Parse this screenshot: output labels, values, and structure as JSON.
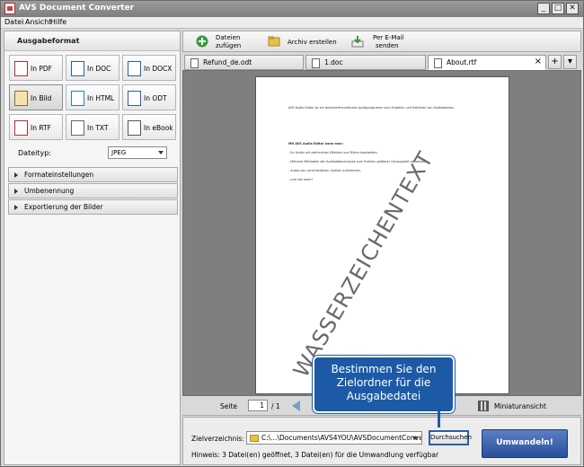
{
  "window": {
    "title": "AVS Document Converter",
    "controls": {
      "minimize": "_",
      "maximize": "□",
      "close": "✕"
    }
  },
  "menu": [
    "Datei",
    "Ansicht",
    "Hilfe"
  ],
  "left_panel": {
    "header": "Ausgabeformat",
    "formats": [
      "In PDF",
      "In DOC",
      "In DOCX",
      "In Bild",
      "In HTML",
      "In ODT",
      "In RTF",
      "In TXT",
      "In eBook"
    ],
    "active_format": "In Bild",
    "dateityp_label": "Dateityp:",
    "dateityp_value": "JPEG",
    "sections": [
      "Formateinstellungen",
      "Umbenennung",
      "Exportierung der Bilder"
    ]
  },
  "toolbar": {
    "add_files": [
      "Dateien",
      "zufügen"
    ],
    "create_archive": "Archiv erstellen",
    "send_email": [
      "Per E-Mail",
      "senden"
    ]
  },
  "tabs": [
    {
      "label": "Refund_de.odt"
    },
    {
      "label": "1.doc"
    },
    {
      "label": "About.rtf"
    }
  ],
  "tab_controls": {
    "close": "×",
    "add": "+",
    "menu": "▾"
  },
  "preview": {
    "watermark": "WASSERZEICHENTEXT",
    "lines": [
      "AVS Audio Editor ist ein benutzerfreundliches Audioprogramm zum Erstellen und Editieren von Audiodateien.",
      "Mit AVS Audio Editor kann man:",
      "- Ihr Audio mit zahlreichen Effekten und Filtern bearbeiten,",
      "- Mehrere Methoden der Audiodatenanalyse zum Erzielen größerer Genauigkeit verwenden,",
      "- Audio von verschiedenen Quellen aufnehmen,",
      "- und viel mehr!"
    ]
  },
  "nav": {
    "page_label": "Seite",
    "page_value": "1",
    "page_total": "/ 1",
    "thumbnails_label": "Miniaturansicht"
  },
  "bottom": {
    "target_label": "Zielverzeichnis:",
    "path": "C:\\...\\Documents\\AVS4YOU\\AVSDocumentConverter",
    "browse": "Durchsuchen",
    "convert": "Umwandeln!",
    "hint": "Hinweis: 3 Datei(en) geöffnet, 3 Datei(en) für die Umwandlung verfügbar"
  },
  "callout": [
    "Bestimmen Sie den",
    "Zielordner für die",
    "Ausgabedatei"
  ]
}
